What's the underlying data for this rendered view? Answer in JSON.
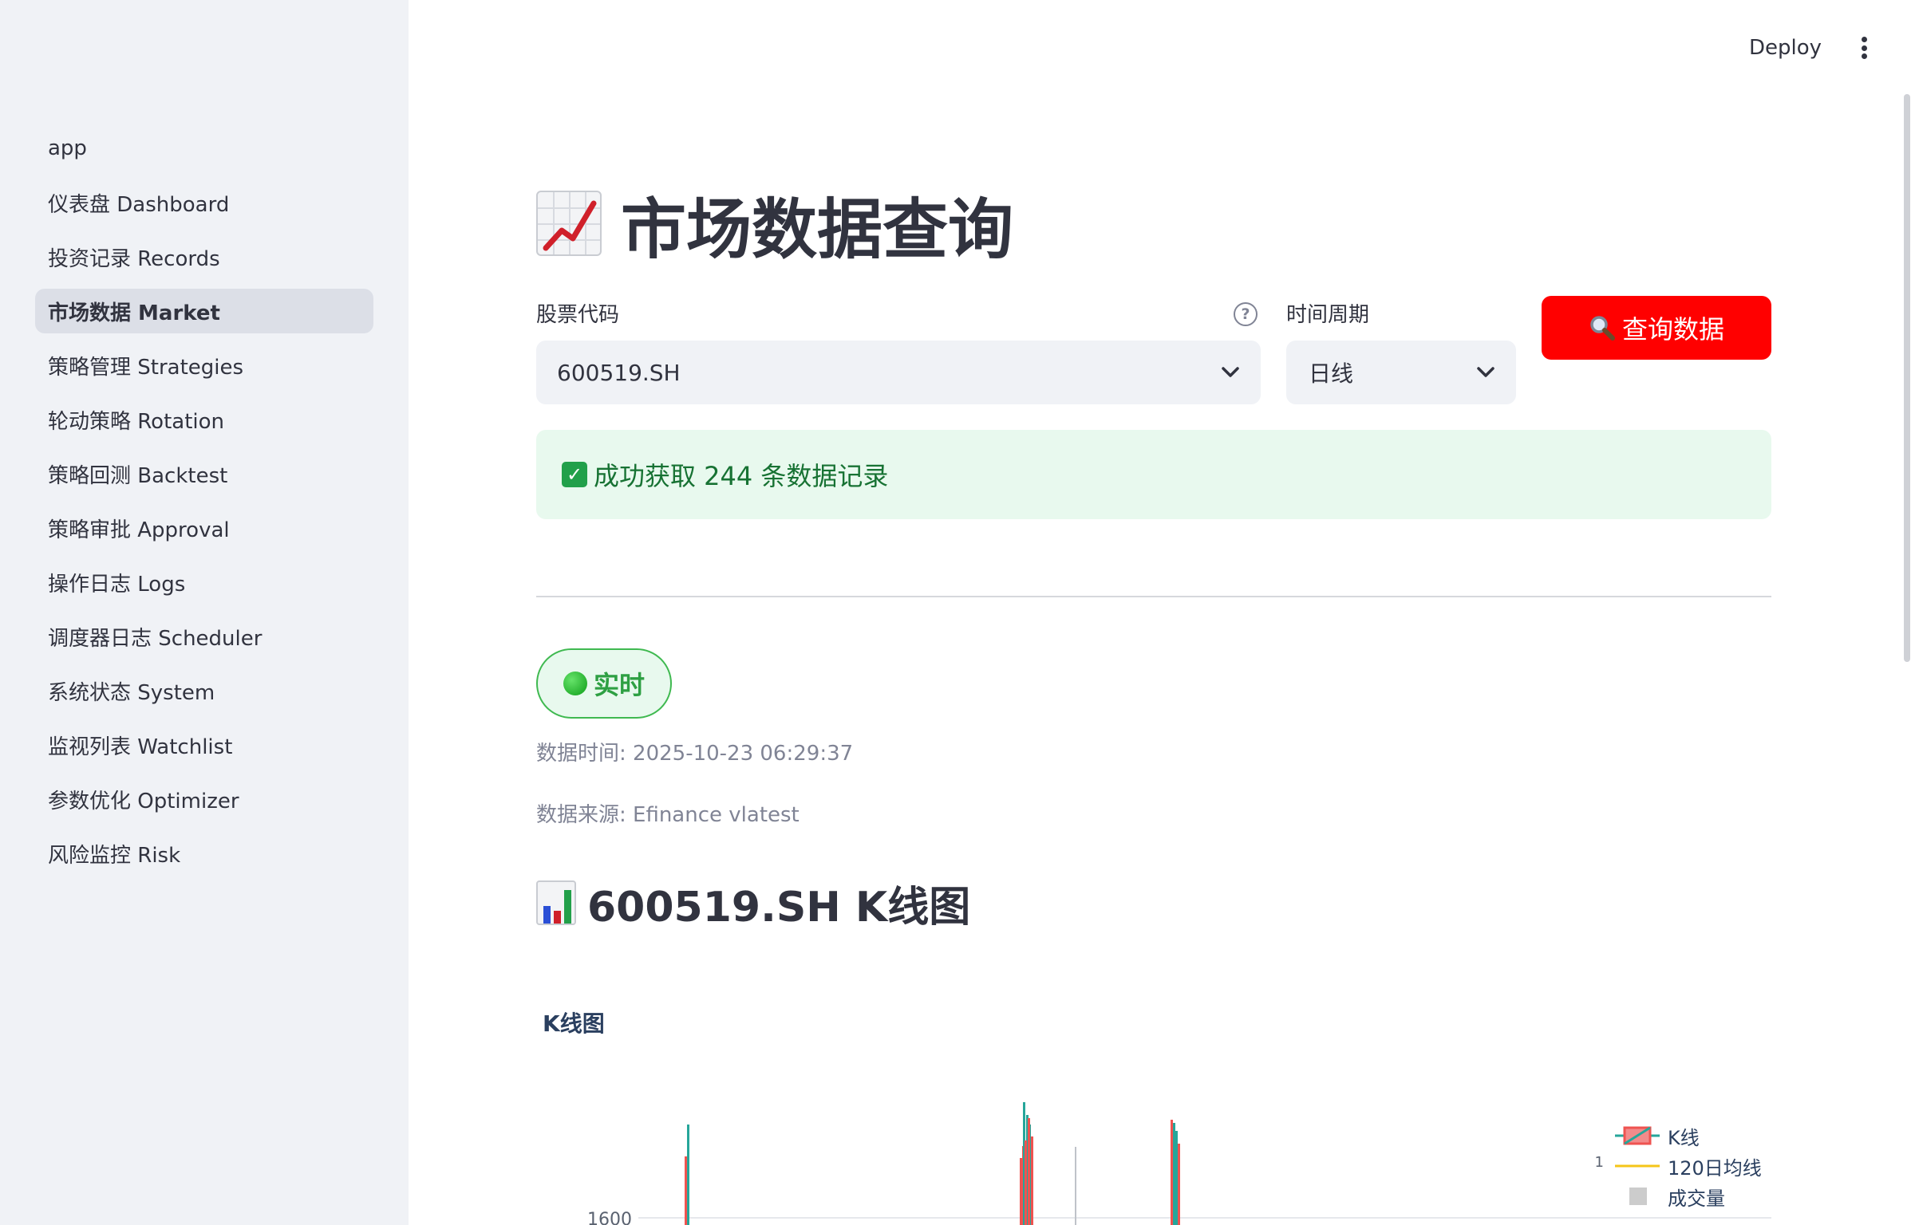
{
  "header": {
    "deploy_label": "Deploy"
  },
  "sidebar": {
    "items": [
      {
        "label": "app",
        "active": false
      },
      {
        "label": "仪表盘 Dashboard",
        "active": false
      },
      {
        "label": "投资记录 Records",
        "active": false
      },
      {
        "label": "市场数据 Market",
        "active": true
      },
      {
        "label": "策略管理 Strategies",
        "active": false
      },
      {
        "label": "轮动策略 Rotation",
        "active": false
      },
      {
        "label": "策略回测 Backtest",
        "active": false
      },
      {
        "label": "策略审批 Approval",
        "active": false
      },
      {
        "label": "操作日志 Logs",
        "active": false
      },
      {
        "label": "调度器日志 Scheduler",
        "active": false
      },
      {
        "label": "系统状态 System",
        "active": false
      },
      {
        "label": "监视列表 Watchlist",
        "active": false
      },
      {
        "label": "参数优化 Optimizer",
        "active": false
      },
      {
        "label": "风险监控 Risk",
        "active": false
      }
    ]
  },
  "main": {
    "title": "市场数据查询",
    "title_icon": "chart-increasing-icon",
    "stock_field": {
      "label": "股票代码",
      "value": "600519.SH"
    },
    "period_field": {
      "label": "时间周期",
      "value": "日线"
    },
    "query_button": {
      "icon": "magnifier-icon",
      "label": "查询数据"
    },
    "success_message": "成功获取 244 条数据记录",
    "live_badge": "实时",
    "data_time": "数据时间: 2025-10-23 06:29:37",
    "data_source": "数据来源: Efinance vlatest",
    "chart_heading": "600519.SH K线图",
    "chart_heading_icon": "bar-chart-icon"
  },
  "colors": {
    "accent": "#ff0000",
    "success_bg": "#e8f9ee",
    "success_text": "#177233",
    "candle_up": "#ef5350",
    "candle_down": "#26a69a",
    "ma_line": "#f5c518",
    "volume": "#cccccc"
  },
  "chart_data": {
    "type": "candlestick",
    "title": "K线图",
    "legend": [
      "K线",
      "120日均线",
      "成交量"
    ],
    "legend_position": "top-right",
    "y_ticks": [
      "1600"
    ],
    "secondary_y_ticks": [
      "1"
    ],
    "grid": true
  }
}
